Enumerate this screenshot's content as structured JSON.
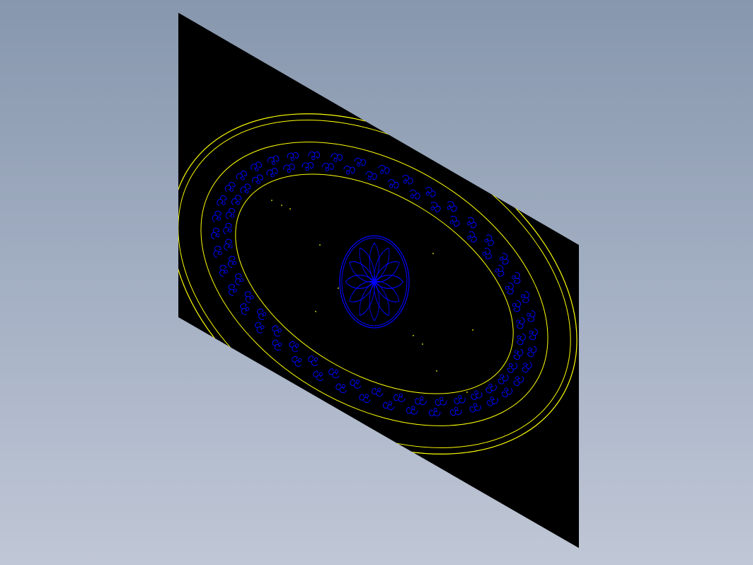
{
  "viewport": {
    "background_top": "#8797ad",
    "background_bottom": "#c0c7d6"
  },
  "model": {
    "panel_color": "#000000",
    "outer_ring_color": "#ffff00",
    "pattern_color": "#0000ff",
    "rosette_petals": 12,
    "border_motif_count": 84
  }
}
